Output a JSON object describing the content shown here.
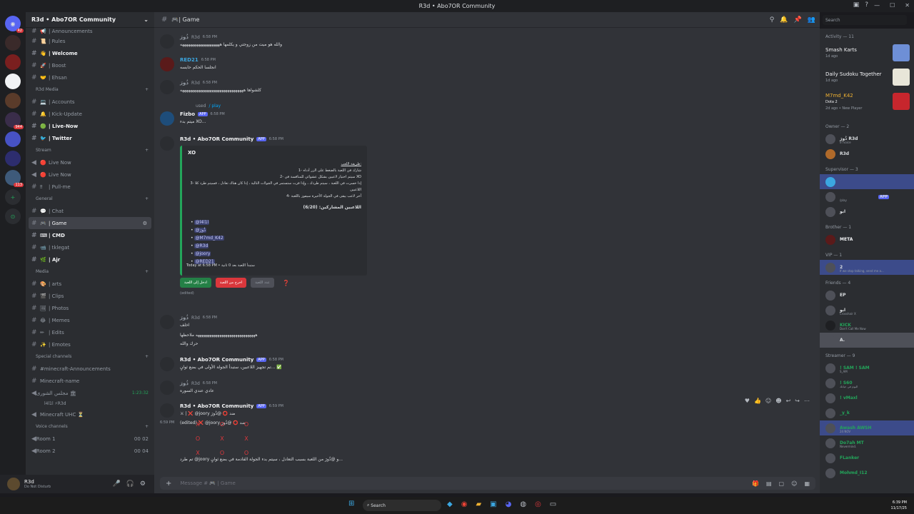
{
  "window": {
    "title": "R3d • Abo7OR Community"
  },
  "guilds": [
    {
      "icon": "discord-home",
      "badge": "42"
    },
    {
      "icon": "server",
      "badge": ""
    },
    {
      "icon": "server",
      "badge": ""
    },
    {
      "icon": "server",
      "badge": ""
    },
    {
      "icon": "server",
      "badge": ""
    },
    {
      "icon": "server",
      "badge": "944"
    },
    {
      "icon": "server",
      "badge": ""
    },
    {
      "icon": "server",
      "badge": ""
    },
    {
      "icon": "server",
      "badge": "113"
    }
  ],
  "server": {
    "name": "R3d • Abo7OR Community"
  },
  "channels": {
    "top": [
      {
        "type": "text",
        "emoji": "📢",
        "label": "| Announcements",
        "bold": false
      },
      {
        "type": "text",
        "emoji": "📜",
        "label": "| Rules",
        "bold": false
      },
      {
        "type": "text",
        "emoji": "👋",
        "label": "| Welcome",
        "bold": true
      },
      {
        "type": "text",
        "emoji": "🚀",
        "label": "| Boost",
        "bold": false
      },
      {
        "type": "text",
        "emoji": "🤝",
        "label": "| Ehsan",
        "bold": false
      }
    ],
    "media_cat": "R3d Media",
    "media": [
      {
        "type": "text",
        "emoji": "💻",
        "label": "| Accounts",
        "bold": false
      },
      {
        "type": "text",
        "emoji": "🔔",
        "label": "| Kick-Update",
        "bold": false
      },
      {
        "type": "text",
        "emoji": "🟢",
        "label": "| Live-Now",
        "bold": true
      },
      {
        "type": "text",
        "emoji": "🐦",
        "label": "| Twitter",
        "bold": true
      }
    ],
    "stream_cat": "Stream",
    "stream": [
      {
        "type": "voice",
        "emoji": "🔴",
        "label": "Live Now"
      },
      {
        "type": "voice",
        "emoji": "🔴",
        "label": "Live Now"
      },
      {
        "type": "text",
        "emoji": "‼",
        "label": "| Pull-me"
      }
    ],
    "general_cat": "General",
    "general": [
      {
        "type": "text",
        "emoji": "💬",
        "label": "| Chat",
        "bold": false,
        "active": false
      },
      {
        "type": "text",
        "emoji": "🎮",
        "label": "| Game",
        "bold": true,
        "active": true
      },
      {
        "type": "text",
        "emoji": "⌨",
        "label": "| CMD",
        "bold": true,
        "active": false
      },
      {
        "type": "text",
        "emoji": "📹",
        "label": "| tklegat",
        "bold": false,
        "active": false
      },
      {
        "type": "text",
        "emoji": "🌿",
        "label": "| Ajr",
        "bold": true,
        "active": false
      }
    ],
    "media2_cat": "Media",
    "media2": [
      {
        "emoji": "🎨",
        "label": "| arts"
      },
      {
        "emoji": "🎬",
        "label": "| Clips"
      },
      {
        "emoji": "🖼",
        "label": "| Photos"
      },
      {
        "emoji": "😂",
        "label": "| Memes"
      },
      {
        "emoji": "✏",
        "label": "| Edits"
      },
      {
        "emoji": "✨",
        "label": "| Emotes"
      }
    ],
    "special_cat": "Special channels",
    "special": [
      {
        "label": "#minecraft-Announcements"
      },
      {
        "label": "Minecraft-name"
      }
    ],
    "voice_room": {
      "label": "مجلس الشورى 🏛",
      "time": "1:23:32",
      "user": "l4l1l ⚡R3d"
    },
    "minecraft_uhc": "Minecraft UHC ⏳",
    "voice_cat": "Voice channels",
    "rooms": [
      {
        "label": "Room 1",
        "count_a": "00",
        "count_b": "02"
      },
      {
        "label": "Room 2",
        "count_a": "00",
        "count_b": "04"
      }
    ]
  },
  "user": {
    "name": "R3d",
    "status": "Do Not Disturb"
  },
  "channel_header": {
    "name": "| Game"
  },
  "search": {
    "placeholder": "Search"
  },
  "messages": {
    "m1": {
      "author": "ذُورَ",
      "tag": "R3d",
      "time": "6:58 PM",
      "text": "والله هو ميت من زوجتي و يكلمها ههههههههههههههههههههه"
    },
    "m2": {
      "author": "RED21",
      "tag": "",
      "time": "6:58 PM",
      "text": "انجلسا الحكم حابسه"
    },
    "m3": {
      "author": "ذُورَ",
      "tag": "R3d",
      "time": "6:58 PM",
      "text": "كلشواها ههههههههههههههههههههههههههههههههه"
    },
    "m4": {
      "used": "used",
      "cmd": "/ play",
      "author": "Fizbo",
      "app": "APP",
      "time": "6:58 PM",
      "text": "ميتم بدء XO..."
    },
    "m5": {
      "author": "R3d • Abo7OR Community",
      "app": "APP",
      "time": "6:58 PM"
    },
    "embed": {
      "title": "XO",
      "rules_title": "طريقة اللعب:",
      "rules": [
        "1- شارك في اللعبة بالضغط على الزر أدناه",
        "2- سيتم اختيار لاعبين بشكل عشوائي للمنافسة في XO",
        "3- إذا خسرت في اللعبة ، سيتم طردك ، وإذا فزت ستستمر في الجولات التالية ، إذا كان هناك تعادل ، فسيتم طرد كلا اللاعبين",
        "4- آخر لاعب يبقى في الجولة الأخيرة سيفوز باللعبة"
      ],
      "players_title": "اللاعبين المشاركين: (6/20)",
      "players": [
        "@l4l1l",
        "@ذُورَ",
        "@M7md_K42",
        "@R3d",
        "@joory",
        "@RED21"
      ],
      "footer": "Today at 6:58 PM • ستبدأ اللعبة بعد 0 ثانية"
    },
    "buttons": {
      "join": "ادخل إلى اللعبة",
      "leave": "اخرج من اللعبة",
      "count": "عدد اللعبة",
      "edited": "(edited)"
    },
    "m6": {
      "author": "ذُورَ",
      "tag": "R3d",
      "time": "6:58 PM",
      "line1": "اخلف",
      "line2": "ههههههههههههههههههههههههههههههه ملاحظها",
      "line3": "حرك والله"
    },
    "m7": {
      "author": "R3d • Abo7OR Community",
      "app": "APP",
      "time": "6:58 PM",
      "text": "تم تجهيز اللاعبين، ستبدأ الجولة الأولى في بضع ثوانٍ... ✅"
    },
    "m8": {
      "author": "ذُورَ",
      "tag": "R3d",
      "time": "6:58 PM",
      "text": "عادي عندي السوره"
    },
    "m9": {
      "author": "R3d • Abo7OR Community",
      "app": "APP",
      "time": "6:59 PM",
      "line1": "⚔ | ❌ @joory ضد ⭕ @ذُورَ",
      "line2": "(edited) ❌ @joory ضد ⭕ @ذُورَ",
      "side_time": "6:59 PM",
      "board": [
        "X",
        "O",
        "O",
        "O",
        "X",
        "X",
        "X",
        "O",
        "O"
      ],
      "result": "تم طرد @joory و @ذُورَ من اللعبة بسبب التعادل ، سيتم بدء الجولة القادمة في بضع ثوانٍ..."
    }
  },
  "composer": {
    "placeholder": "Message # 🎮 | Game"
  },
  "members": {
    "activity_title": "Activity — 11",
    "activities": [
      {
        "name": "Smash Karts",
        "sub": "1d ago",
        "color": "#6e8fd6"
      },
      {
        "name": "Daily Sudoku Together",
        "sub": "1d ago",
        "color": "#e8e6d9"
      },
      {
        "name": "M7md_K42",
        "sub": "Dota 2",
        "sub2": "2d ago • New Player",
        "color": "#c7262d"
      }
    ],
    "owner_title": "Owner — 2",
    "owners": [
      {
        "name": "ذُورَ R3d",
        "status": "In voice",
        "color": "#dbdee1"
      },
      {
        "name": "R3d",
        "status": "",
        "color": "#dbdee1"
      }
    ],
    "supervisor_title": "Supervisor — 3",
    "supervisors": [
      {
        "name": "",
        "status": "",
        "color": "#5865f2"
      },
      {
        "name": "APP",
        "status": "/play",
        "color": "#dbdee1"
      },
      {
        "name": "ابو",
        "status": "",
        "color": "#dbdee1"
      }
    ],
    "brother_title": "Brother — 1",
    "brothers": [
      {
        "name": "META",
        "status": "",
        "color": "#da373c"
      }
    ],
    "vip_title": "VIP — 1",
    "vips": [
      {
        "name": "2",
        "status": "If we stop talking, send me a...",
        "color": "#5865f2"
      }
    ],
    "friends_title": "Friends — 4",
    "friends": [
      {
        "name": "EP",
        "status": "",
        "color": "#5865f2"
      },
      {
        "name": "ابو",
        "status": "Crosshair X",
        "color": "#5865f2"
      },
      {
        "name": "KICK",
        "status": "Don't Call Me Now",
        "color": "#23a55a"
      },
      {
        "name": "A.",
        "status": "",
        "color": "#5865f2"
      }
    ],
    "streamer_title": "Streamer — 9",
    "streamers": [
      {
        "name": "! SAM ! SAM",
        "status": "S_AM",
        "color": "#23a55a"
      },
      {
        "name": "! S60",
        "status": "اليوم في حياتك",
        "color": "#23a55a"
      },
      {
        "name": "! vMaxl",
        "status": "",
        "color": "#23a55a"
      },
      {
        "name": "_y_k",
        "status": "",
        "color": "#23a55a"
      },
      {
        "name": "Awash AWSH",
        "status": "24 NOV",
        "color": "#23a55a"
      },
      {
        "name": "Do7ah MT",
        "status": "Nevermind.",
        "color": "#23a55a"
      },
      {
        "name": "FLanker",
        "status": "",
        "color": "#23a55a"
      },
      {
        "name": "Mohmd_I12",
        "status": "",
        "color": "#23a55a"
      }
    ]
  },
  "taskbar": {
    "search": "Search",
    "time": "6:39 PM",
    "date": "11/17/25"
  }
}
